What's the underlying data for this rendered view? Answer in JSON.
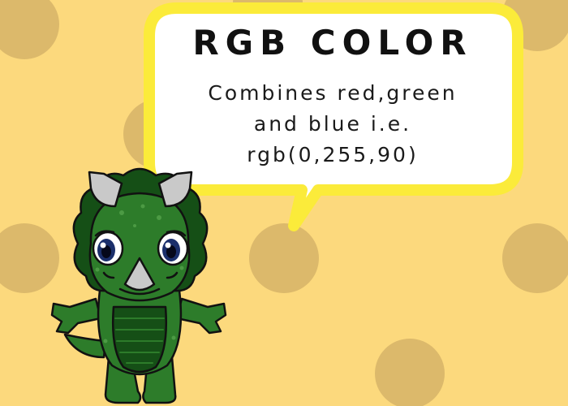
{
  "colors": {
    "background": "#fcd97d",
    "dot": "#dcb96b",
    "bubble_fill": "#ffffff",
    "bubble_border": "#fbeb3a",
    "dino_green": "#2d7c2a",
    "dino_dark": "#154f16",
    "horn": "#c9c9c9",
    "eye_iris": "#1b2f6b"
  },
  "bubble": {
    "title": "RGB COLOR",
    "lines": [
      "Combines red,green",
      "and blue i.e.",
      "rgb(0,255,90)"
    ]
  },
  "mascot": {
    "icon": "triceratops-mascot-icon"
  }
}
